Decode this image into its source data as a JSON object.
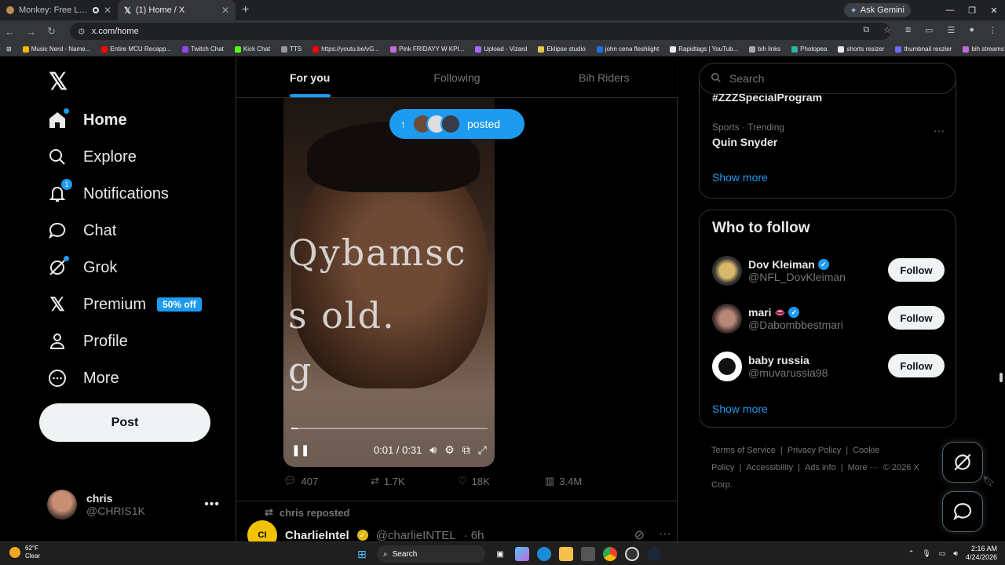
{
  "browser": {
    "tabs": [
      {
        "title": "Monkey: Free Live Video Ch"
      },
      {
        "title": "(1) Home / X"
      }
    ],
    "ask_gemini": "Ask Gemini",
    "url": "x.com/home",
    "bookmarks": [
      "Music Nerd - Name...",
      "Entire MCU Recapp...",
      "Twitch Chat",
      "Kick Chat",
      "TTS",
      "https://youtu.be/vG...",
      "Pink FRIDAYY W KPI...",
      "Upload - Vizard",
      "Eklipse studio",
      "john cena fleshlight",
      "Rapidtags | YouTub...",
      "bih links",
      "Photopea",
      "shorts resizer",
      "thumbnail reszier",
      "bih streams"
    ]
  },
  "nav": {
    "items": [
      {
        "label": "Home",
        "icon": "home-icon"
      },
      {
        "label": "Explore",
        "icon": "search-icon"
      },
      {
        "label": "Notifications",
        "icon": "bell-icon",
        "badge": "1"
      },
      {
        "label": "Chat",
        "icon": "chat-icon"
      },
      {
        "label": "Grok",
        "icon": "grok-icon"
      },
      {
        "label": "Premium",
        "icon": "x-icon",
        "tag": "50% off"
      },
      {
        "label": "Profile",
        "icon": "person-icon"
      },
      {
        "label": "More",
        "icon": "more-circle-icon"
      }
    ],
    "post_label": "Post",
    "account": {
      "name": "chris",
      "handle": "@CHRIS1K"
    }
  },
  "feed": {
    "tabs": [
      "For you",
      "Following",
      "Bih Riders"
    ],
    "posted_pill": "posted",
    "video": {
      "time": "0:01 / 0:31",
      "scrawl_1": "Qybamsc",
      "scrawl_2": "s old.",
      "scrawl_3": "g",
      "progress": 0.03
    },
    "actions": {
      "replies": "407",
      "reposts": "1.7K",
      "likes": "18K",
      "views": "3.4M"
    },
    "next_post": {
      "reposted_by": "chris reposted",
      "name": "CharlieIntel",
      "handle": "@charlieINTEL",
      "time": "· 6h",
      "logo": "CI"
    }
  },
  "sidebar": {
    "search_placeholder": "Search",
    "trend_cut": "#ZZZSpecialProgram",
    "trend_meta": "Sports · Trending",
    "trend_title": "Quin Snyder",
    "show_more": "Show more",
    "who_to_follow": "Who to follow",
    "users": [
      {
        "name": "Dov Kleiman",
        "handle": "@NFL_DovKleiman",
        "verified": true,
        "emoji": ""
      },
      {
        "name": "mari",
        "handle": "@Dabombbestmari",
        "verified": true,
        "emoji": "👄"
      },
      {
        "name": "baby russia",
        "handle": "@muvarussia98",
        "verified": false,
        "emoji": ""
      }
    ],
    "follow_label": "Follow",
    "footer": [
      "Terms of Service",
      "|",
      "Privacy Policy",
      "|",
      "Cookie Policy",
      "|",
      "Accessibility",
      "|",
      "Ads info",
      "|",
      "More ···",
      "© 2026 X Corp."
    ]
  },
  "taskbar": {
    "temp": "62°F",
    "condition": "Clear",
    "search": "Search",
    "time": "2:16 AM",
    "date": "4/24/2026"
  },
  "colors": {
    "accent": "#1d9bf0",
    "bg": "#000000",
    "text": "#e7e9ea",
    "muted": "#71767b"
  }
}
